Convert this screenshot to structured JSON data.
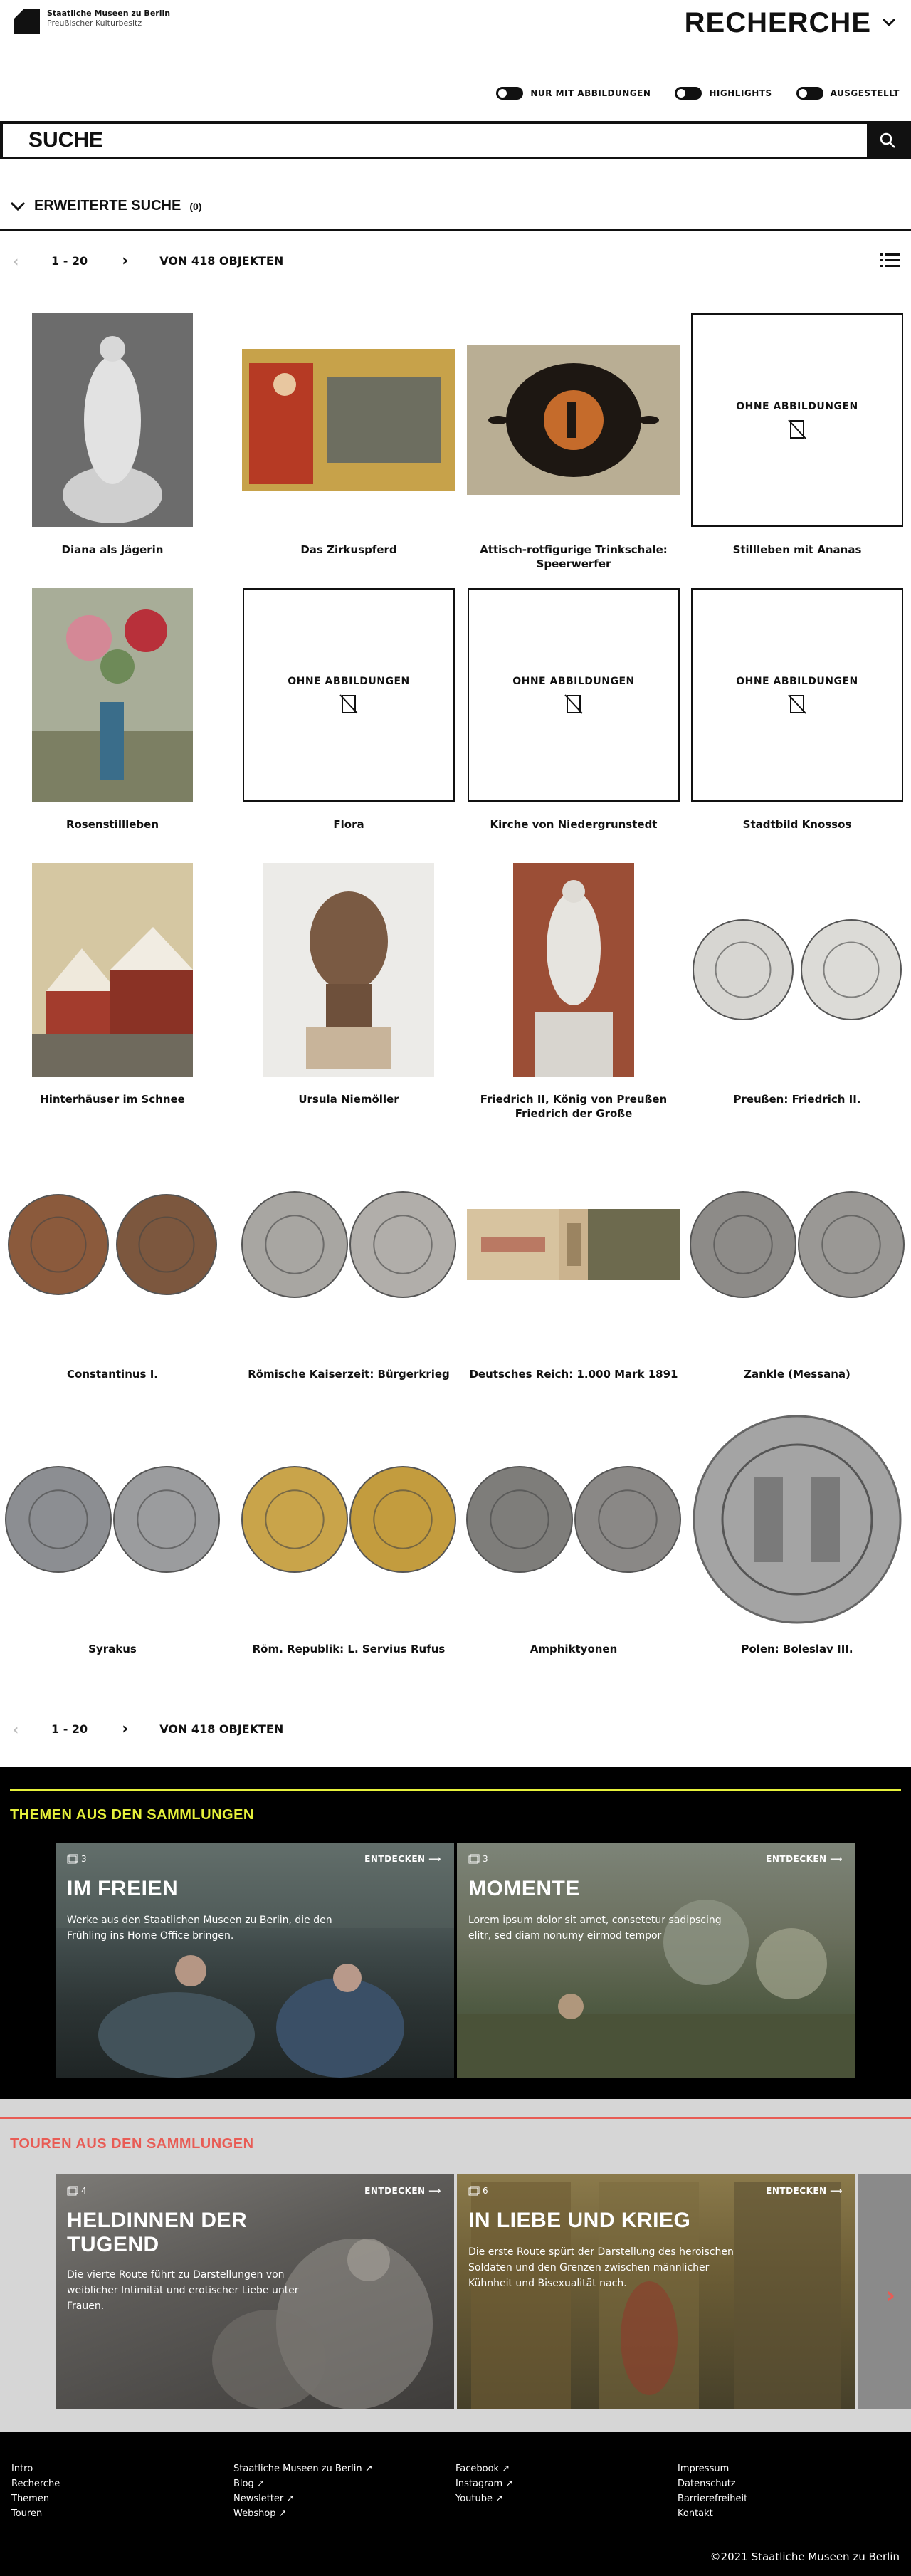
{
  "header": {
    "logo_line1": "Staatliche Museen zu Berlin",
    "logo_line2": "Preußischer Kulturbesitz",
    "title": "RECHERCHE"
  },
  "filters": [
    {
      "label": "NUR MIT ABBILDUNGEN"
    },
    {
      "label": "HIGHLIGHTS"
    },
    {
      "label": "AUSGESTELLT"
    }
  ],
  "search": {
    "placeholder": "SUCHE"
  },
  "advanced": {
    "label": "ERWEITERTE SUCHE",
    "count": "(0)"
  },
  "pagination": {
    "range": "1 - 20",
    "total": "VON 418 OBJEKTEN"
  },
  "no_image_label": "OHNE ABBILDUNGEN",
  "items": [
    {
      "title": "Diana als Jägerin",
      "image": "statue"
    },
    {
      "title": "Das Zirkuspferd",
      "image": "painting-red"
    },
    {
      "title": "Attisch-rotfigurige Trinkschale: Speerwerfer",
      "image": "bowl"
    },
    {
      "title": "Stillleben mit Ananas",
      "image": "none"
    },
    {
      "title": "Rosenstillleben",
      "image": "roses"
    },
    {
      "title": "Flora",
      "image": "none"
    },
    {
      "title": "Kirche von Niedergrunstedt",
      "image": "none"
    },
    {
      "title": "Stadtbild Knossos",
      "image": "none"
    },
    {
      "title": "Hinterhäuser im Schnee",
      "image": "houses"
    },
    {
      "title": "Ursula Niemöller",
      "image": "bust"
    },
    {
      "title": "Friedrich II, König von Preußen Friedrich der Große",
      "image": "monument"
    },
    {
      "title": "Preußen: Friedrich II.",
      "image": "coins-silver"
    },
    {
      "title": "Constantinus I.",
      "image": "coins-bronze"
    },
    {
      "title": "Römische Kaiserzeit: Bürgerkrieg",
      "image": "coins-silver2"
    },
    {
      "title": "Deutsches Reich: 1.000 Mark 1891",
      "image": "banknote"
    },
    {
      "title": "Zankle (Messana)",
      "image": "coins-silver3"
    },
    {
      "title": "Syrakus",
      "image": "coins-silver4"
    },
    {
      "title": "Röm. Republik: L. Servius Rufus",
      "image": "coins-gold"
    },
    {
      "title": "Amphiktyonen",
      "image": "coins-silver5"
    },
    {
      "title": "Polen: Boleslav III.",
      "image": "coin-large"
    }
  ],
  "themes": {
    "title": "THEMEN AUS DEN SAMMLUNGEN",
    "cards": [
      {
        "count": "3",
        "cta": "ENTDECKEN",
        "title": "IM FREIEN",
        "text": "Werke aus den Staatlichen Museen zu Berlin, die den Frühling ins Home Office bringen."
      },
      {
        "count": "3",
        "cta": "ENTDECKEN",
        "title": "MOMENTE",
        "text": "Lorem ipsum dolor sit amet, consetetur sadipscing elitr, sed diam nonumy eirmod tempor"
      }
    ]
  },
  "tours": {
    "title": "TOUREN AUS DEN SAMMLUNGEN",
    "cards": [
      {
        "count": "4",
        "cta": "ENTDECKEN",
        "title": "HELDINNEN DER TUGEND",
        "text": "Die vierte Route führt zu Darstellungen von weiblicher Intimität und erotischer Liebe unter Frauen."
      },
      {
        "count": "6",
        "cta": "ENTDECKEN",
        "title": "IN LIEBE UND KRIEG",
        "text": "Die erste Route spürt der Darstellung des heroischen Soldaten und den Grenzen zwischen männlicher Kühnheit und Bisexualität nach."
      }
    ]
  },
  "footer": {
    "col1": [
      "Intro",
      "Recherche",
      "Themen",
      "Touren"
    ],
    "col2": [
      "Staatliche Museen zu Berlin",
      "Blog",
      "Newsletter",
      "Webshop"
    ],
    "col3": [
      "Facebook",
      "Instagram",
      "Youtube"
    ],
    "col4": [
      "Impressum",
      "Datenschutz",
      "Barrierefreiheit",
      "Kontakt"
    ],
    "copyright": "©2021 Staatliche Museen zu Berlin"
  },
  "colors": {
    "themes_accent": "#e6f13b",
    "tours_accent": "#e85c55"
  }
}
